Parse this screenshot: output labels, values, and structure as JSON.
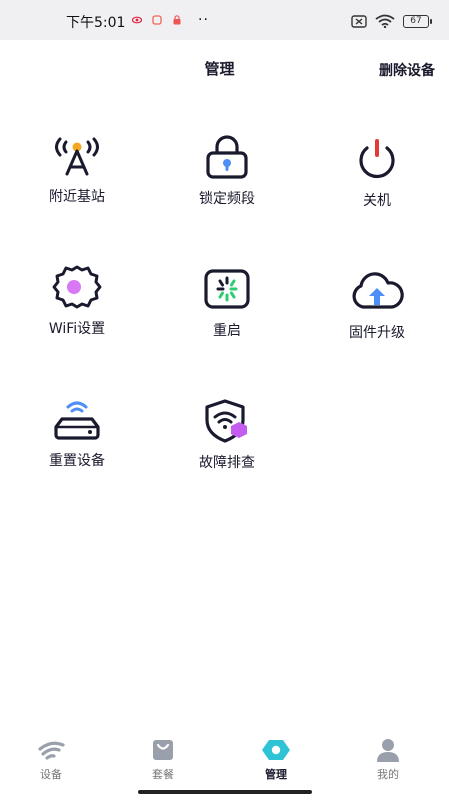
{
  "status_bar": {
    "time": "下午5:01",
    "dots": "··",
    "battery": "67"
  },
  "header": {
    "title": "管理",
    "action_label": "删除设备"
  },
  "grid": {
    "items": [
      {
        "label": "附近基站",
        "icon": "cell-tower-icon"
      },
      {
        "label": "锁定频段",
        "icon": "lock-icon"
      },
      {
        "label": "关机",
        "icon": "power-icon"
      },
      {
        "label": "WiFi设置",
        "icon": "gear-icon"
      },
      {
        "label": "重启",
        "icon": "restart-icon"
      },
      {
        "label": "固件升级",
        "icon": "cloud-upload-icon"
      },
      {
        "label": "重置设备",
        "icon": "router-icon"
      },
      {
        "label": "故障排查",
        "icon": "shield-wifi-icon"
      }
    ]
  },
  "tabs": {
    "items": [
      {
        "label": "设备",
        "icon": "wifi-signal-icon"
      },
      {
        "label": "套餐",
        "icon": "bag-icon"
      },
      {
        "label": "管理",
        "icon": "hexagon-icon",
        "active": true
      },
      {
        "label": "我的",
        "icon": "user-icon"
      }
    ]
  },
  "colors": {
    "accent": "#2ec4d6",
    "text": "#1a1a2e",
    "inactive": "#9aa0ab",
    "purple": "#c45cf0"
  }
}
